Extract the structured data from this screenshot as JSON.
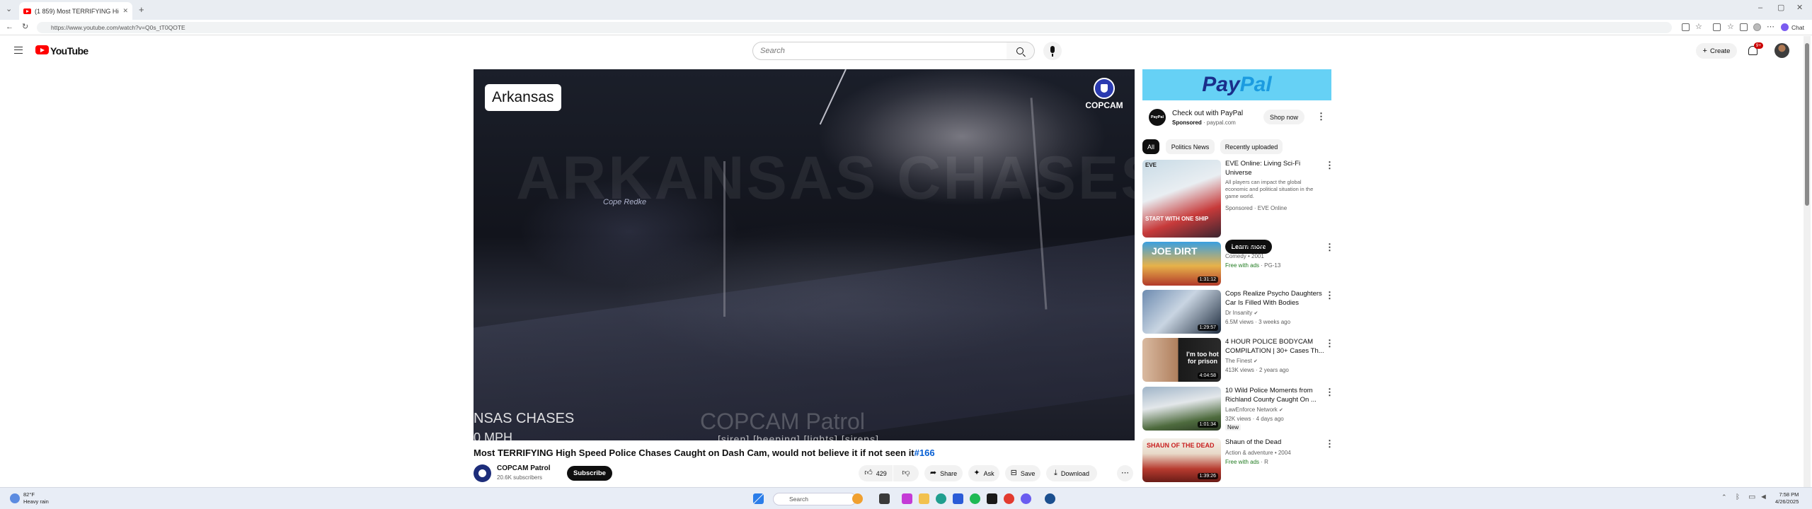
{
  "browser": {
    "tab_title": "(1 859) Most TERRIFYING High",
    "url": "https://www.youtube.com/watch?v=Q0s_tT0QOTE",
    "chat_label": "Chat"
  },
  "header": {
    "logo_text": "YouTube",
    "search_placeholder": "Search",
    "create_label": "Create",
    "notifications_count": "9+"
  },
  "player": {
    "state_label": "Arkansas",
    "brand_badge": "COPCAM",
    "overlay_watermark": "ARKANSAS CHASES",
    "sign_text": "Cope Redke",
    "corner_text": "NSAS CHASES",
    "speed_text": "0 MPH",
    "patrol_watermark": "COPCAM Patrol",
    "subtitle_text": "[siren] [beeping] [lights] [sirens]"
  },
  "video": {
    "title": "Most TERRIFYING High Speed Police Chases Caught on Dash Cam, would not believe it if not seen it",
    "title_tag": "#166",
    "channel_name": "COPCAM Patrol",
    "subscribers": "20.6K subscribers",
    "subscribe_label": "Subscribe",
    "likes": "429",
    "share_label": "Share",
    "ask_label": "Ask",
    "save_label": "Save",
    "download_label": "Download"
  },
  "ad": {
    "banner_text_1": "Pay",
    "banner_text_2": "Pal",
    "logo_text": "PayPal",
    "title": "Check out with PayPal",
    "sponsored": "Sponsored",
    "domain": "paypal.com",
    "cta": "Shop now"
  },
  "chips": [
    "All",
    "Politics News",
    "Recently uploaded"
  ],
  "recommendations": [
    {
      "title": "EVE Online: Living Sci-Fi Universe",
      "desc": "All players can impact the global economic and political situation in the game world.",
      "meta": "Sponsored · EVE Online",
      "cta": "Learn more",
      "thumb_text": "START WITH ONE SHIP",
      "thumb_logo": "EVE"
    },
    {
      "title": "Joe Dirt (2001)",
      "line2": "Comedy • 2001",
      "badge": "Free with ads",
      "rating": "· PG-13",
      "duration": "1:31:12",
      "thumb_text": "JOE DIRT"
    },
    {
      "title": "Cops Realize Psycho Daughters Car Is Filled With Bodies",
      "line2": "Dr Insanity",
      "line3": "6.5M views · 3 weeks ago",
      "duration": "1:29:57"
    },
    {
      "title": "4 HOUR POLICE BODYCAM COMPILATION | 30+ Cases Th...",
      "line2": "The Finest",
      "line3": "413K views · 2 years ago",
      "duration": "4:04:58",
      "thumb_text": "I'm too hot for prison"
    },
    {
      "title": "10 Wild Police Moments from Richland County Caught On ...",
      "line2": "LawEnforce Network",
      "line3": "32K views · 4 days ago",
      "line4": "New",
      "duration": "1:01:34"
    },
    {
      "title": "Shaun of the Dead",
      "line2": "Action & adventure • 2004",
      "badge": "Free with ads",
      "rating": "· R",
      "duration": "1:39:26",
      "thumb_text": "SHAUN OF THE DEAD"
    }
  ],
  "taskbar": {
    "weather_temp": "82°F",
    "weather_desc": "Heavy rain",
    "search_placeholder": "Search",
    "time": "7:58 PM",
    "date": "4/26/2025"
  },
  "colors": {
    "youtube_red": "#ff0000",
    "link_blue": "#065fd4",
    "paypal_sky": "#66d1f5",
    "paypal_navy": "#1a2e8a"
  }
}
